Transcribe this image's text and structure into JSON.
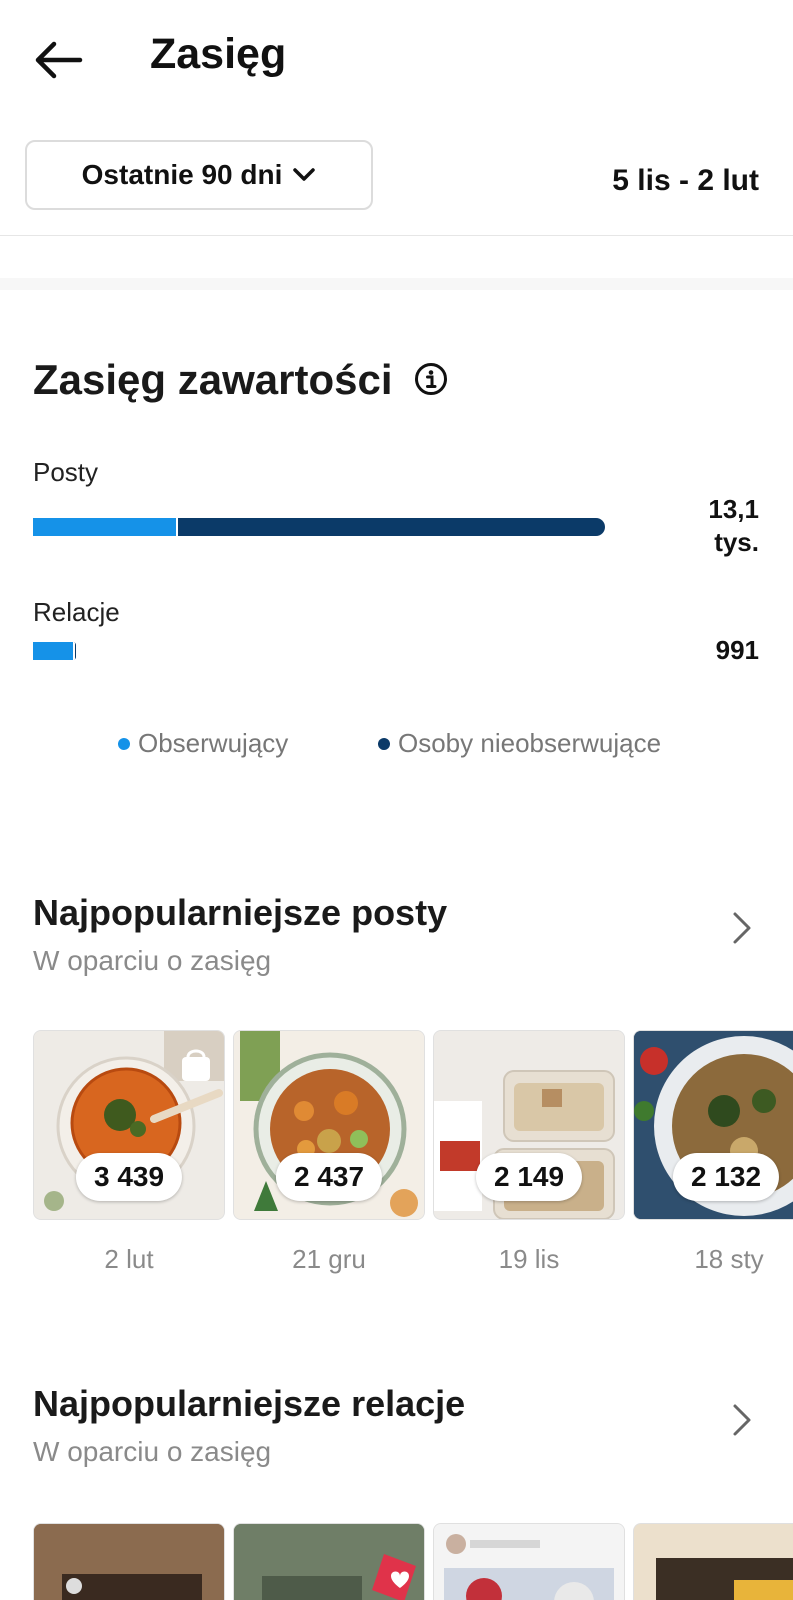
{
  "header": {
    "title": "Zasięg"
  },
  "range": {
    "label": "Ostatnie 90 dni",
    "dates": "5 lis - 2 lut"
  },
  "content_reach": {
    "title": "Zasięg zawartości",
    "rows": [
      {
        "label": "Posty",
        "value_line1": "13,1",
        "value_line2": "tys.",
        "followers_share": 0.25,
        "total_fraction": 1.0
      },
      {
        "label": "Relacje",
        "value_line1": "991",
        "value_line2": "",
        "followers_share": 0.92,
        "total_fraction": 0.076
      }
    ],
    "legend": [
      {
        "label": "Obserwujący",
        "color": "#1592e8"
      },
      {
        "label": "Osoby nieobserwujące",
        "color": "#0b3a68"
      }
    ]
  },
  "top_posts": {
    "title": "Najpopularniejsze posty",
    "subtitle": "W oparciu o zasięg",
    "items": [
      {
        "count": "3 439",
        "date": "2 lut",
        "image": "soup"
      },
      {
        "count": "2 437",
        "date": "21 gru",
        "image": "chickpea-salad"
      },
      {
        "count": "2 149",
        "date": "19 lis",
        "image": "sesame-dessert"
      },
      {
        "count": "2 132",
        "date": "18 sty",
        "image": "pasta"
      }
    ]
  },
  "top_stories": {
    "title": "Najpopularniejsze relacje",
    "subtitle": "W oparciu o zasięg"
  },
  "colors": {
    "followers": "#1592e8",
    "non_followers": "#0b3a68"
  }
}
